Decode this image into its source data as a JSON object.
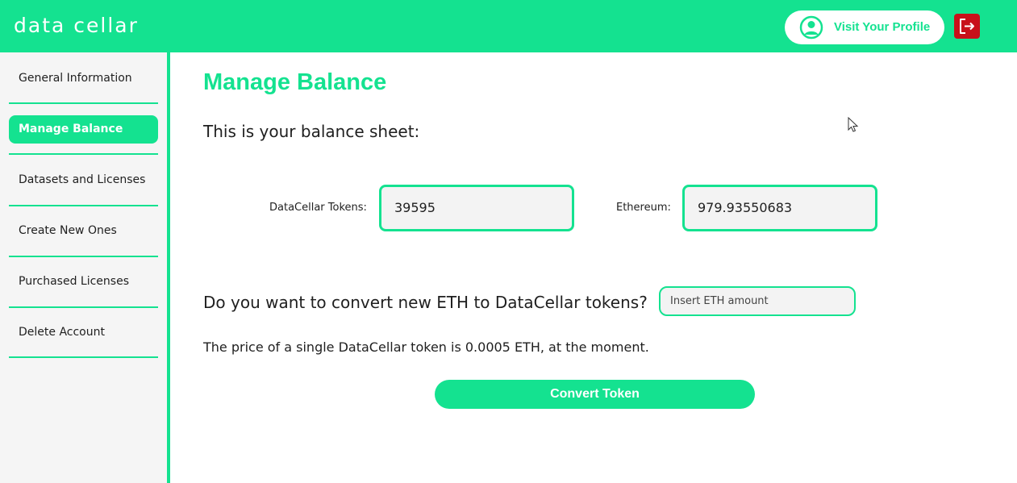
{
  "app": {
    "logo_text": "data cellar",
    "brand_color": "#14e290",
    "logout_color": "#c8101a"
  },
  "header": {
    "profile_label": "Visit Your Profile",
    "profile_icon": "user-circle-icon",
    "logout_icon": "logout-icon"
  },
  "sidebar": {
    "items": [
      {
        "label": "General Information",
        "active": false
      },
      {
        "label": "Manage Balance",
        "active": true
      },
      {
        "label": "Datasets and Licenses",
        "active": false
      },
      {
        "label": "Create New Ones",
        "active": false
      },
      {
        "label": "Purchased Licenses",
        "active": false
      },
      {
        "label": "Delete Account",
        "active": false
      }
    ]
  },
  "main": {
    "title": "Manage Balance",
    "balance_heading": "This is your balance sheet:",
    "tokens_label": "DataCellar Tokens:",
    "tokens_value": "39595",
    "eth_label": "Ethereum:",
    "eth_value": "979.93550683",
    "convert_question": "Do you want to convert new ETH to DataCellar tokens?",
    "eth_input_placeholder": "Insert ETH amount",
    "price_text": "The price of a single DataCellar token is 0.0005 ETH, at the moment.",
    "convert_button_label": "Convert Token"
  }
}
